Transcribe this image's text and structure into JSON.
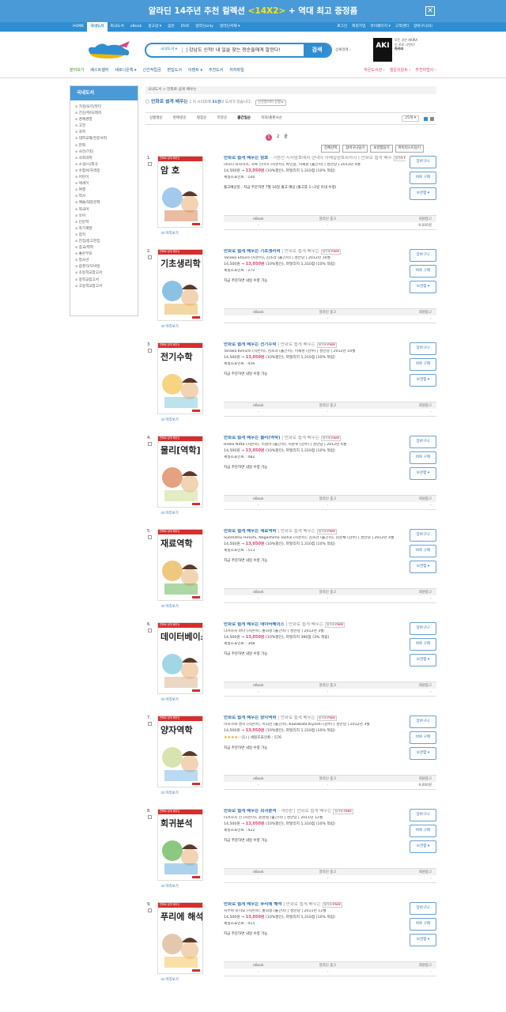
{
  "banner": {
    "text": "알라딘 14주년 추천 컬렉션 ",
    "hl": "<14X2>",
    "text2": " + 역대 최고 증정품",
    "close": "✕"
  },
  "topnav": {
    "left": [
      "HOME",
      "국내도서",
      "외국도서",
      "eBook",
      "중고샵 ▾",
      "음반",
      "DVD",
      "알라딘only",
      "알라딘서재 ▾"
    ],
    "right": [
      "로그인",
      "회원가입",
      "마이페이지 ▾",
      "고객센터",
      "장바구니(0)"
    ]
  },
  "search": {
    "category": "국내도서 ▾",
    "query": "| 강남도 신작! 내 일을 찾는 청순들에게 말한다!",
    "button": "검색",
    "detail": "상세검색 ›"
  },
  "ad": {
    "logo": "AKI",
    "line1": "모든 것은 AKIRA",
    "line2": "인 로로 나빈다!",
    "name": "아키라"
  },
  "cats": {
    "left": [
      "분야보기",
      "베스트셀러",
      "새로나온책 ▾",
      "신간적립금",
      "편집도서",
      "이벤트 ▾",
      "추천도서",
      "저자파일"
    ],
    "right": [
      "작은도서관 ›",
      "행운의원트 ›",
      "추천마법사 ›"
    ]
  },
  "side": {
    "title": "국내도서",
    "items": [
      "가정/요리/뷰티",
      "건강/취미/레저",
      "경제경영",
      "고전",
      "과학",
      "대학교재/전문서적",
      "만화",
      "사전/기타",
      "사회과학",
      "소설/시/희곡",
      "수험서/자격증",
      "어린이",
      "에세이",
      "여행",
      "역사",
      "예술/대중문화",
      "외국어",
      "유아",
      "인문학",
      "자기계발",
      "잡지",
      "전집/중고전집",
      "종교/역학",
      "좋은부모",
      "청소년",
      "컴퓨터/모바일",
      "초등학교참고서",
      "중학교참고서",
      "고등학교참고서"
    ]
  },
  "crumb": "국내도서 > 만화로 쉽게 배우는",
  "series": {
    "title": "만화로 쉽게 배우는 :",
    "desc1": " 이 시리즈에 ",
    "count": "31권",
    "desc2": "의 도서가 있습니다.",
    "pill": "신간알리미 신청 ▸"
  },
  "sort": {
    "items": [
      "상품명순",
      "판매량순",
      "평점순",
      "리뷰순",
      "출간일순",
      "저자/출판사순"
    ],
    "active": 4,
    "count": "25개 ▾"
  },
  "pager": [
    "1",
    "2",
    "끝"
  ],
  "tools": [
    "전체선택",
    "장바구니담기",
    "보관함담기",
    "마이리스트담기"
  ],
  "table_headers": [
    "eBook",
    "알라딘 중고",
    "회원중고"
  ],
  "buttons": [
    "장바구니",
    "바로 구매",
    "보관함 ▾"
  ],
  "preview": "미리보기",
  "items": [
    {
      "num": "1.",
      "cover": "암 호",
      "title": "만화로 쉽게 배우는 암호",
      "sub": " - 기원전 시저암호에서 현대의 이메일암호화까지 | 만화로 쉽게 배우",
      "author": "미타니 미사히카, 사토 신이치 (지은이), 박인용, 이재원 (옮긴이) | 성안당 | 2013년 4월",
      "price": "14,500원 → ",
      "price2": "13,050원",
      "pct": " (10%할인), 마일리지 1,310점 (10% 적립)",
      "point": "세일즈포인트 : 100",
      "delivery": "출고예상일 : 지금 주문하면 7월 16일 출고 예상 (출고후 1~2일 이내 수령)",
      "used": "-",
      "usedm": "9,000원"
    },
    {
      "num": "2.",
      "cover": "기초생리학",
      "title": "만화로 쉽게 배우는 기초생리학",
      "sub": " | 만화로 쉽게 배우는",
      "author": "Tanaka Etsuro (지은이), 김소라 (옮긴이) | 성안당 | 2012년 10월",
      "price": "14,500원 → ",
      "price2": "13,050원",
      "pct": " (10%할인), 마일리지 1,310점 (10% 적립)",
      "point": "세일즈포인트 : 272",
      "delivery": "지금 주문하면 내일 수령 가능",
      "used": "-",
      "usedm": "-"
    },
    {
      "num": "3.",
      "cover": "전기수학",
      "title": "만화로 쉽게 배우는 전기수학",
      "sub": " | 만화로 쉽게 배우는",
      "author": "Tanaka Kenichi (지은이), 김소라 (옮긴이), 이재원 (감수) | 성안당 | 2012년 10월",
      "price": "14,500원 → ",
      "price2": "13,050원",
      "pct": " (10%할인), 마일리지 1,310점 (10% 적립)",
      "point": "세일즈포인트 : 456",
      "delivery": "지금 주문하면 내일 수령 가능",
      "used": "-",
      "usedm": "-"
    },
    {
      "num": "4.",
      "cover": "물리[역학]",
      "title": "만화로 쉽게 배우는 물리(역학)",
      "sub": " | 만화로 쉽게 배우는",
      "author": "Hideo Nitta (지은이), 이정아 (옮긴이), 이준우 (감수) | 성안당 | 2012년 6월",
      "price": "14,500원 → ",
      "price2": "13,050원",
      "pct": " (10%할인), 마일리지 1,310점 (10% 적립)",
      "point": "세일즈포인트 : 482",
      "delivery": "지금 주문하면 내일 수령 가능",
      "used": "-",
      "usedm": "-"
    },
    {
      "num": "5.",
      "cover": "재료역학",
      "title": "만화로 쉽게 배우는 재료역학",
      "sub": " | 만화로 쉽게 배우는",
      "author": "Suematsu Hiroshi, Nagashima Toshio (지은이), 김소라 (옮긴이), 김순채 (감수) | 성안당 | 2012년 4월",
      "price": "14,500원 → ",
      "price2": "13,050원",
      "pct": " (10%할인), 마일리지 1,310점 (10% 적립)",
      "point": "세일즈포인트 : 513",
      "delivery": "지금 주문하면 내일 수령 가능",
      "used": "-",
      "usedm": "-"
    },
    {
      "num": "6.",
      "cover": "데이터베이스",
      "title": "만화로 쉽게 배우는 데이터베이스",
      "sub": " | 만화로 쉽게 배우는",
      "author": "다카하시 마나 (지은이), 홍희정 (옮긴이) | 성안당 | 2012년 3월",
      "price": "14,500원 → ",
      "price2": "13,050원",
      "pct": " (10%할인), 마일리지 390점 (3% 적립)",
      "point": "세일즈포인트 : 308",
      "delivery": "지금 주문하면 내일 수령 가능",
      "used": "-",
      "usedm": "-"
    },
    {
      "num": "7.",
      "cover": "양자역학",
      "title": "만화로 쉽게 배우는 양자역학",
      "sub": " | 만화로 쉽게 배우는",
      "author": "이시가와 켄지 (지은이), 이희찬 (옮긴이), Kawabata Kiyoshi (감수) | 성안당 | 2012년 3월",
      "price": "14,500원 → ",
      "price2": "13,050원",
      "pct": " (10%할인), 마일리지 1,310점 (10% 적립)",
      "point": "(1) | 세일즈포인트 : 576",
      "stars": "★★★★☆",
      "delivery": "지금 주문하면 내일 수령 가능",
      "used": "-",
      "usedm": "9,000원"
    },
    {
      "num": "8.",
      "cover": "회귀분석",
      "title": "만화로 쉽게 배우는 회귀분석",
      "sub": " - 개정판 | 만화로 쉽게 배우는",
      "author": "타카하시 신 (지은이), 윤성철 (옮긴이) | 성안당 | 2011년 12월",
      "price": "14,500원 → ",
      "price2": "13,050원",
      "pct": " (10%할인), 마일리지 1,310점 (10% 적립)",
      "point": "세일즈포인트 : 422",
      "delivery": "지금 주문하면 내일 수령 가능",
      "used": "-",
      "usedm": "-"
    },
    {
      "num": "9.",
      "cover": "푸리에 해석",
      "title": "만화로 쉽게 배우는 푸리에 해석",
      "sub": " | 만화로 쉽게 배우는",
      "author": "시부야 미치오 (지은이), 홍희정 (옮긴이) | 성안당 | 2011년 12월",
      "price": "14,500원 → ",
      "price2": "13,050원",
      "pct": " (10%할인), 마일리지 1,310점 (10% 적립)",
      "point": "세일즈포인트 : 415",
      "delivery": "지금 주문하면 내일 수령 가능",
      "used": "-",
      "usedm": "-"
    }
  ],
  "cover_top": "만화로 쉽게 배우는",
  "sale_badge": "정가제 ",
  "sale_free": "FREE",
  "colors": {
    "accent": "#2e8ed3",
    "pink": "#e0457b"
  }
}
